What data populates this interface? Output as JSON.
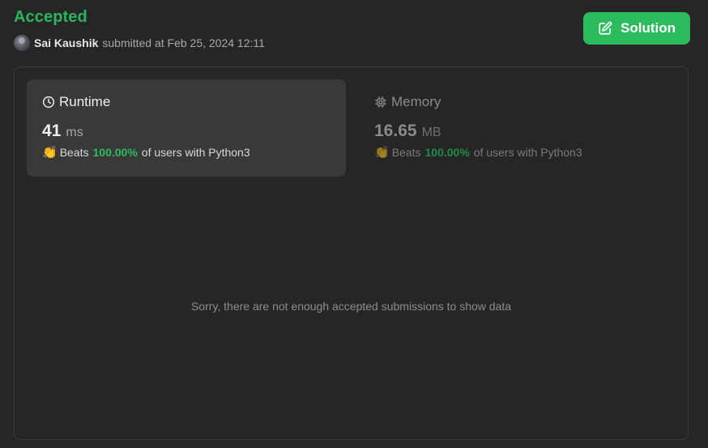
{
  "submission": {
    "status": "Accepted",
    "username": "Sai Kaushik",
    "submitted_text": "submitted at Feb 25, 2024 12:11",
    "status_color": "#2db55d"
  },
  "toolbar": {
    "solution_label": "Solution",
    "solution_icon": "edit-icon",
    "button_color": "#2cbb5d"
  },
  "runtime": {
    "label": "Runtime",
    "icon": "clock-icon",
    "value": "41",
    "unit": "ms",
    "beats_prefix": "Beats",
    "beats_pct": "100.00%",
    "beats_suffix": "of users with Python3"
  },
  "memory": {
    "label": "Memory",
    "icon": "chip-icon",
    "value": "16.65",
    "unit": "MB",
    "beats_prefix": "Beats",
    "beats_pct": "100.00%",
    "beats_suffix": "of users with Python3"
  },
  "chart_area": {
    "empty_message": "Sorry, there are not enough accepted submissions to show data"
  }
}
